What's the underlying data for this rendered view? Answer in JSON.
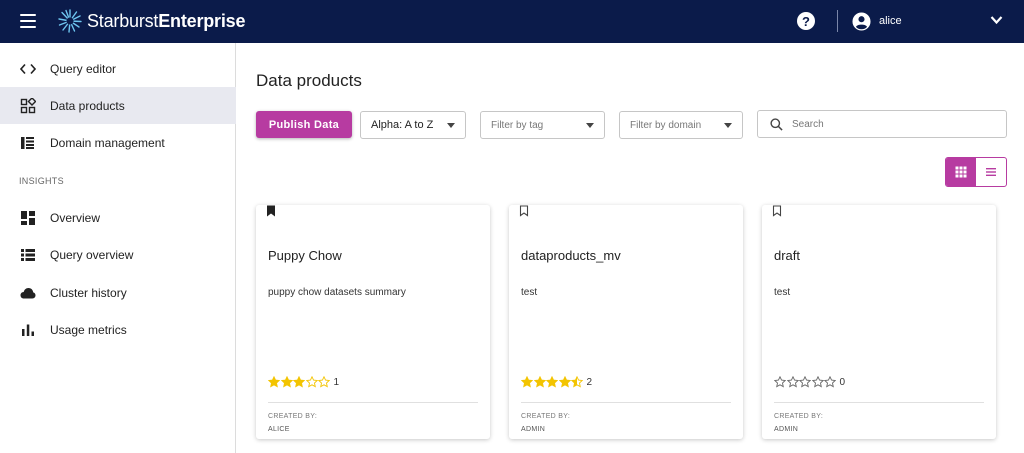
{
  "app": {
    "brand_light": "Starburst",
    "brand_bold": "Enterprise",
    "help_label": "?",
    "user_name": "alice"
  },
  "colors": {
    "topbar": "#0b1b4a",
    "accent": "#b73ba1",
    "star": "#f3c400",
    "active_nav": "#e8e9f0"
  },
  "sidebar": {
    "items": [
      {
        "label": "Query editor",
        "icon": "code-icon"
      },
      {
        "label": "Data products",
        "icon": "data-products-icon",
        "active": true
      },
      {
        "label": "Domain management",
        "icon": "domain-icon"
      }
    ],
    "insights_heading": "INSIGHTS",
    "insights": [
      {
        "label": "Overview",
        "icon": "dashboard-icon"
      },
      {
        "label": "Query overview",
        "icon": "list-icon"
      },
      {
        "label": "Cluster history",
        "icon": "cloud-icon"
      },
      {
        "label": "Usage metrics",
        "icon": "bar-chart-icon"
      }
    ]
  },
  "main": {
    "title": "Data products",
    "publish_label": "Publish Data",
    "sort_value": "Alpha: A to Z",
    "filter_tag_placeholder": "Filter by tag",
    "filter_domain_placeholder": "Filter by domain",
    "search_placeholder": "Search"
  },
  "cards": [
    {
      "title": "Puppy Chow",
      "description": "puppy chow datasets summary",
      "bookmarked": true,
      "rating": 3,
      "rating_count": "1",
      "created_label": "CREATED BY:",
      "created_by": "ALICE"
    },
    {
      "title": "dataproducts_mv",
      "description": "test",
      "bookmarked": false,
      "rating": 4.5,
      "rating_count": "2",
      "created_label": "CREATED BY:",
      "created_by": "ADMIN"
    },
    {
      "title": "draft",
      "description": "test",
      "bookmarked": false,
      "rating": 0,
      "rating_count": "0",
      "created_label": "CREATED BY:",
      "created_by": "ADMIN"
    }
  ]
}
